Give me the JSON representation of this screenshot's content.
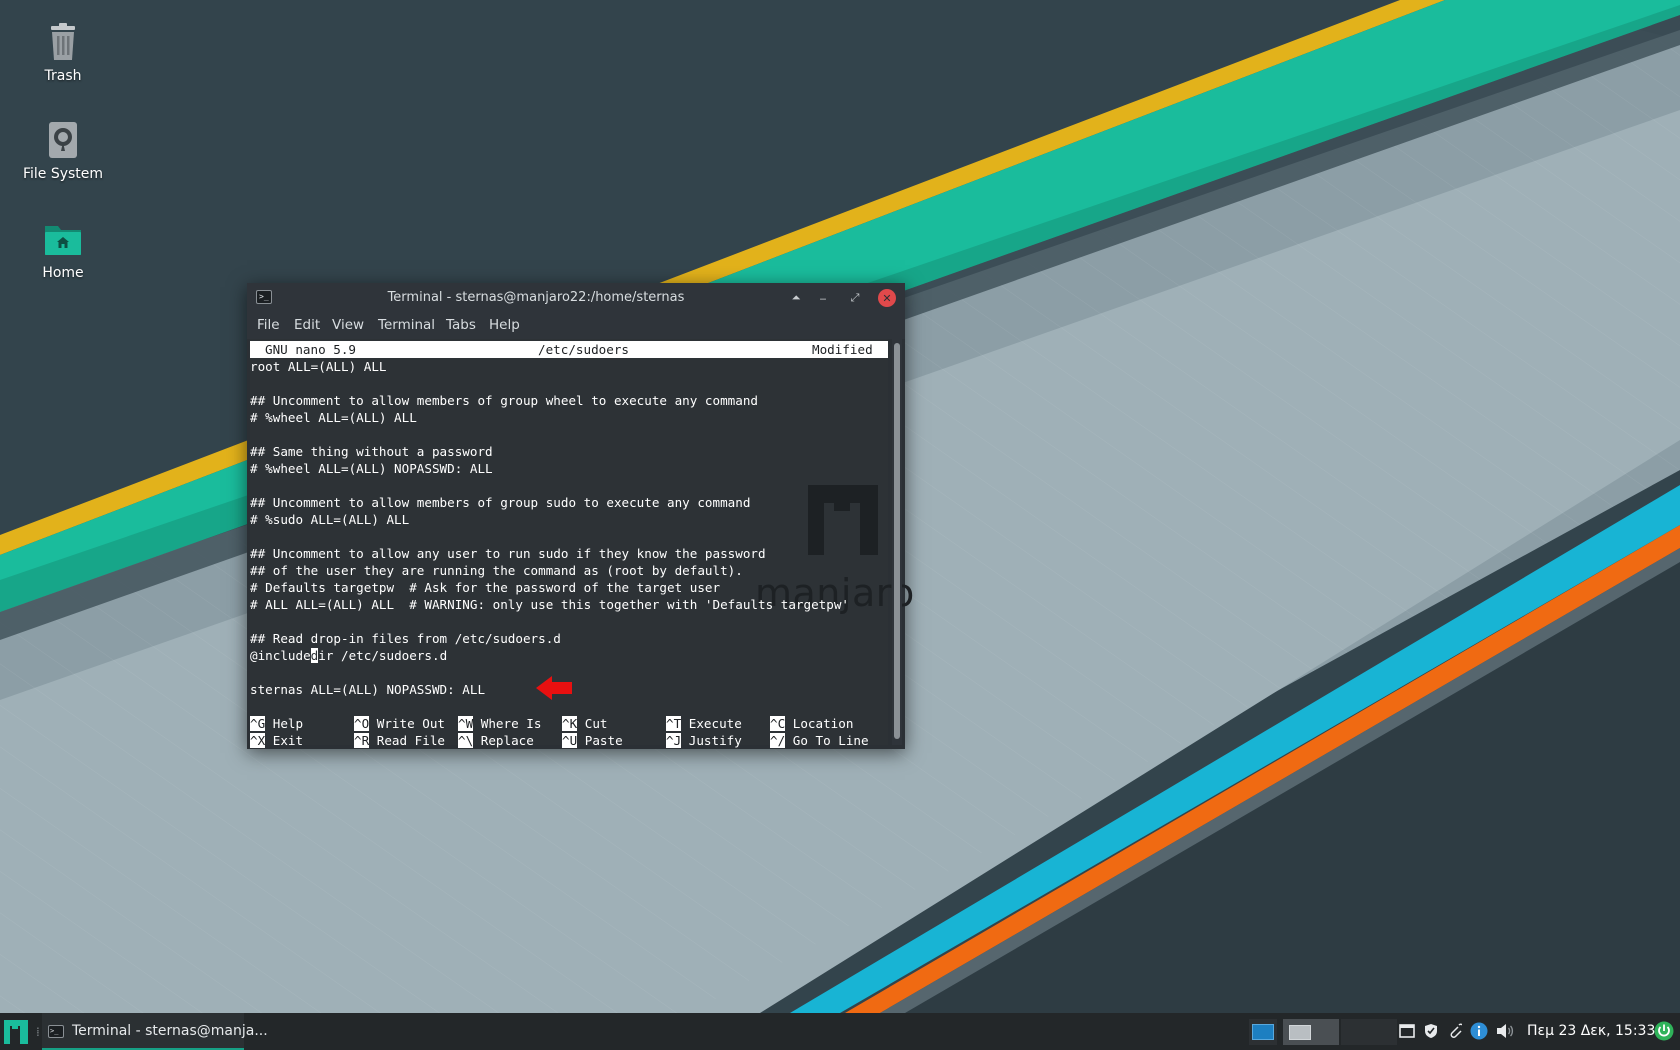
{
  "desktop": {
    "icons": [
      {
        "label": "Trash",
        "icon": "trash-icon"
      },
      {
        "label": "File System",
        "icon": "drive-icon"
      },
      {
        "label": "Home",
        "icon": "home-folder-icon"
      }
    ],
    "wallpaper_text": "manjaro"
  },
  "window": {
    "title": "Terminal - sternas@manjaro22:/home/sternas",
    "menu": [
      "File",
      "Edit",
      "View",
      "Terminal",
      "Tabs",
      "Help"
    ],
    "controls": {
      "keep_above": "⏶",
      "minimize": "‒",
      "maximize": "⤢",
      "close": "✕"
    }
  },
  "nano": {
    "header": {
      "version": "GNU nano 5.9",
      "filename": "/etc/sudoers",
      "status": "Modified"
    },
    "lines": [
      "root ALL=(ALL) ALL",
      "",
      "## Uncomment to allow members of group wheel to execute any command",
      "# %wheel ALL=(ALL) ALL",
      "",
      "## Same thing without a password",
      "# %wheel ALL=(ALL) NOPASSWD: ALL",
      "",
      "## Uncomment to allow members of group sudo to execute any command",
      "# %sudo ALL=(ALL) ALL",
      "",
      "## Uncomment to allow any user to run sudo if they know the password",
      "## of the user they are running the command as (root by default).",
      "# Defaults targetpw  # Ask for the password of the target user",
      "# ALL ALL=(ALL) ALL  # WARNING: only use this together with 'Defaults targetpw'",
      "",
      "## Read drop-in files from /etc/sudoers.d",
      "",
      "",
      "sternas ALL=(ALL) NOPASSWD: ALL"
    ],
    "include_line": {
      "before": "@include",
      "cursor": "d",
      "after": "ir /etc/sudoers.d"
    },
    "shortcuts_row1": [
      {
        "key": "^G",
        "label": "Help"
      },
      {
        "key": "^O",
        "label": "Write Out"
      },
      {
        "key": "^W",
        "label": "Where Is"
      },
      {
        "key": "^K",
        "label": "Cut"
      },
      {
        "key": "^T",
        "label": "Execute"
      },
      {
        "key": "^C",
        "label": "Location"
      }
    ],
    "shortcuts_row2": [
      {
        "key": "^X",
        "label": "Exit"
      },
      {
        "key": "^R",
        "label": "Read File"
      },
      {
        "key": "^\\",
        "label": "Replace"
      },
      {
        "key": "^U",
        "label": "Paste"
      },
      {
        "key": "^J",
        "label": "Justify"
      },
      {
        "key": "^/",
        "label": "Go To Line"
      }
    ]
  },
  "taskbar": {
    "task_label": "Terminal - sternas@manja...",
    "clock": "Πεμ 23 Δεκ, 15:33",
    "tray_icons": [
      "clipboard-icon",
      "shield-icon",
      "paperclip-icon",
      "info-icon",
      "volume-icon",
      "power-icon"
    ]
  },
  "colors": {
    "accent": "#16a085",
    "teal_stripe": "#1abc9c",
    "yellow_stripe": "#e2b21b",
    "cyan_stripe": "#18b4d4",
    "orange_stripe": "#f06a12",
    "close_button": "#e0494b",
    "arrow": "#e81010"
  }
}
